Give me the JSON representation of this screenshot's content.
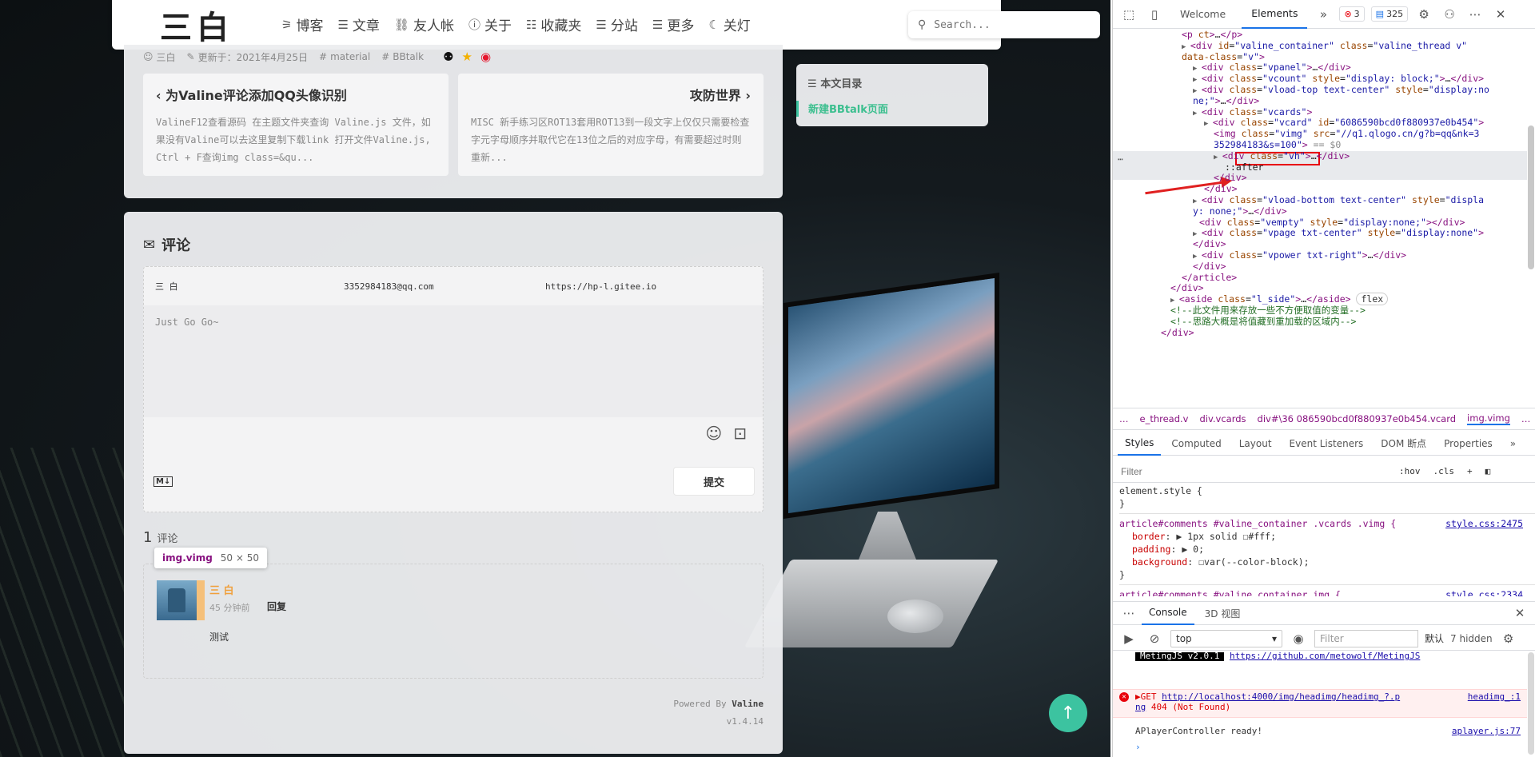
{
  "site": {
    "logo": "三白",
    "nav": [
      {
        "icon": "rss-icon",
        "glyph": "⚞",
        "label": "博客"
      },
      {
        "icon": "list-icon",
        "glyph": "☰",
        "label": "文章"
      },
      {
        "icon": "link-icon",
        "glyph": "⛓",
        "label": "友人帐"
      },
      {
        "icon": "info-icon",
        "glyph": "ⓘ",
        "label": "关于"
      },
      {
        "icon": "bookmark-icon",
        "glyph": "☷",
        "label": "收藏夹"
      },
      {
        "icon": "list-icon",
        "glyph": "☰",
        "label": "分站"
      },
      {
        "icon": "list-icon",
        "glyph": "☰",
        "label": "更多"
      },
      {
        "icon": "moon-icon",
        "glyph": "☾",
        "label": "关灯"
      }
    ],
    "search_placeholder": "Search..."
  },
  "post": {
    "author": "三白",
    "updated": "更新于：2021年4月25日",
    "tags": [
      "material",
      "BBtalk"
    ],
    "prev": {
      "title": "为Valine评论添加QQ头像识别",
      "excerpt": "ValineF12查看源码  在主题文件夹查询  Valine.js 文件，如果没有Valine可以去这里复制下载link 打开文件Valine.js, Ctrl + F查询img class=&qu..."
    },
    "next": {
      "title": "攻防世界",
      "excerpt": "MISC 新手练习区ROT13套用ROT13到一段文字上仅仅只需要检查字元字母顺序并取代它在13位之后的对应字母，有需要超过时则重新..."
    }
  },
  "toc": {
    "title": "本文目录",
    "items": [
      "新建BBtalk页面"
    ]
  },
  "comments": {
    "title": "评论",
    "form": {
      "nick": "三 白",
      "mail": "3352984183@qq.com",
      "link": "https://hp-l.gitee.io",
      "text": "Just Go Go~",
      "submit": "提交"
    },
    "count": "1",
    "count_label": "评论",
    "tooltip": {
      "selector": "img.vimg",
      "size": "50 × 50"
    },
    "items": [
      {
        "name": "三 白",
        "time": "45 分钟前",
        "reply": "回复",
        "text": "测试"
      }
    ],
    "powered_prefix": "Powered By",
    "powered_name": "Valine",
    "version": "v1.4.14"
  },
  "devtools": {
    "tabs": [
      "Welcome",
      "Elements"
    ],
    "errors": "3",
    "messages": "325",
    "dom_lines": [
      {
        "indent": 86,
        "html": "<span class='t'>&lt;p</span> <span class='a'>ct</span><span class='t'>&gt;</span>…<span class='t'>&lt;/p&gt;</span>"
      },
      {
        "indent": 86,
        "html": "<span class='t'>&lt;div</span> <span class='a'>id</span>=<span class='v'>\"valine_container\"</span> <span class='a'>class</span>=<span class='v'>\"valine_thread v\"</span>"
      },
      {
        "indent": 86,
        "html": "<span class='a'>data-class</span>=<span class='v'>\"v\"</span><span class='t'>&gt;</span>"
      },
      {
        "indent": 100,
        "html": "<span class='t'>&lt;div</span> <span class='a'>class</span>=<span class='v'>\"vpanel\"</span><span class='t'>&gt;</span>…<span class='t'>&lt;/div&gt;</span>"
      },
      {
        "indent": 100,
        "html": "<span class='t'>&lt;div</span> <span class='a'>class</span>=<span class='v'>\"vcount\"</span> <span class='a'>style</span>=<span class='v'>\"display: block;\"</span><span class='t'>&gt;</span>…<span class='t'>&lt;/div&gt;</span>"
      },
      {
        "indent": 100,
        "html": "<span class='t'>&lt;div</span> <span class='a'>class</span>=<span class='v'>\"vload-top text-center\"</span> <span class='a'>style</span>=<span class='v'>\"display:no</span>"
      },
      {
        "indent": 100,
        "html": "<span class='v'>ne;\"</span><span class='t'>&gt;</span>…<span class='t'>&lt;/div&gt;</span>"
      },
      {
        "indent": 100,
        "html": "<span class='t'>&lt;div</span> <span class='a'>class</span>=<span class='v'>\"vcards\"</span><span class='t'>&gt;</span>"
      },
      {
        "indent": 114,
        "html": "<span class='t'>&lt;div</span> <span class='a'>class</span>=<span class='v'>\"vcard\"</span> <span class='a'>id</span>=<span class='v'>\"6086590bcd0f880937e0b454\"</span><span class='t'>&gt;</span>"
      },
      {
        "indent": 126,
        "html": "<span class='t'>&lt;img</span> <span class='a'>class</span>=<span class='v'>\"vimg\"</span> <span class='a'>src</span>=<span class='v'>\"//q1.qlogo.cn/g?b=qq&amp;nk=3</span>"
      },
      {
        "indent": 126,
        "html": "<span class='v'>352984183&amp;s=100\"</span><span class='t'>&gt;</span> <span style='color:#888'>== $0</span>"
      },
      {
        "indent": 126,
        "html": "<span class='t'>&lt;div</span> <span class='a'>class</span>=<span class='v'>\"vh\"</span><span class='t'>&gt;</span>…<span class='t'>&lt;/div&gt;</span>"
      },
      {
        "indent": 140,
        "html": "::after"
      },
      {
        "indent": 126,
        "html": "<span class='t'>&lt;/div&gt;</span>"
      },
      {
        "indent": 114,
        "html": "<span class='t'>&lt;/div&gt;</span>"
      },
      {
        "indent": 100,
        "html": "<span class='t'>&lt;div</span> <span class='a'>class</span>=<span class='v'>\"vload-bottom text-center\"</span> <span class='a'>style</span>=<span class='v'>\"displa</span>"
      },
      {
        "indent": 100,
        "html": "<span class='v'>y: none;\"</span><span class='t'>&gt;</span>…<span class='t'>&lt;/div&gt;</span>"
      },
      {
        "indent": 108,
        "html": "<span class='t'>&lt;div</span> <span class='a'>class</span>=<span class='v'>\"vempty\"</span> <span class='a'>style</span>=<span class='v'>\"display:none;\"</span><span class='t'>&gt;&lt;/div&gt;</span>"
      },
      {
        "indent": 100,
        "html": "<span class='t'>&lt;div</span> <span class='a'>class</span>=<span class='v'>\"vpage txt-center\"</span> <span class='a'>style</span>=<span class='v'>\"display:none\"</span><span class='t'>&gt;</span>"
      },
      {
        "indent": 100,
        "html": "<span class='t'>&lt;/div&gt;</span>"
      },
      {
        "indent": 100,
        "html": "<span class='t'>&lt;div</span> <span class='a'>class</span>=<span class='v'>\"vpower txt-right\"</span><span class='t'>&gt;</span>…<span class='t'>&lt;/div&gt;</span>"
      },
      {
        "indent": 100,
        "html": "<span class='t'>&lt;/div&gt;</span>"
      },
      {
        "indent": 86,
        "html": "<span class='t'>&lt;/article&gt;</span>"
      },
      {
        "indent": 72,
        "html": "<span class='t'>&lt;/div&gt;</span>"
      },
      {
        "indent": 72,
        "html": "<span class='t'>&lt;aside</span> <span class='a'>class</span>=<span class='v'>\"l_side\"</span><span class='t'>&gt;</span>…<span class='t'>&lt;/aside&gt;</span> <span style='border:1px solid #ccc;border-radius:8px;padding:0 5px;color:#333'>flex</span>"
      },
      {
        "indent": 72,
        "html": "<span class='c'>&lt;!--此文件用来存放一些不方便取值的变量--&gt;</span>"
      },
      {
        "indent": 72,
        "html": "<span class='c'>&lt;!--思路大概是将值藏到重加载的区域内--&gt;</span>"
      },
      {
        "indent": 60,
        "html": "<span class='t'>&lt;/div&gt;</span>"
      }
    ],
    "breadcrumb": [
      "…",
      "e_thread.v",
      "div.vcards",
      "div#\\36 086590bcd0f880937e0b454.vcard",
      "img.vimg",
      "…"
    ],
    "sub_tabs": [
      "Styles",
      "Computed",
      "Layout",
      "Event Listeners",
      "DOM 断点",
      "Properties"
    ],
    "filter_placeholder": "Filter",
    "hov": ":hov",
    "cls": ".cls",
    "styles": {
      "rule0_selector": "element.style {",
      "rule0_close": "}",
      "rule1_selector": "article#comments #valine_container .vcards .vimg {",
      "rule1_src": "style.css:2475",
      "rule1_props": [
        {
          "name": "border",
          "value": ": ▶ 1px solid ☐#fff;"
        },
        {
          "name": "padding",
          "value": ": ▶ 0;"
        },
        {
          "name": "background",
          "value": ": ☐var(--color-block);"
        }
      ],
      "rule1_close": "}",
      "rule2_selector": "article#comments #valine_container img {",
      "rule2_src": "style.css:2334"
    },
    "console_tabs": [
      "Console",
      "3D 视图"
    ],
    "context": "top",
    "console_filter": "Filter",
    "levels": "默认",
    "hidden": "7 hidden",
    "console": {
      "metings_tag": "MetingJS v2.0.1",
      "metings_link": "https://github.com/metowolf/MetingJS",
      "err_prefix": "▶GET",
      "err_url": "http://localhost:4000/img/headimg/headimg_?.p",
      "err_url2": "ng",
      "err_status": "404 (Not Found)",
      "err_src": "headimg_:1",
      "ready": "APlayerController ready!",
      "ready_src": "aplayer.js:77",
      "prompt": "›"
    }
  }
}
